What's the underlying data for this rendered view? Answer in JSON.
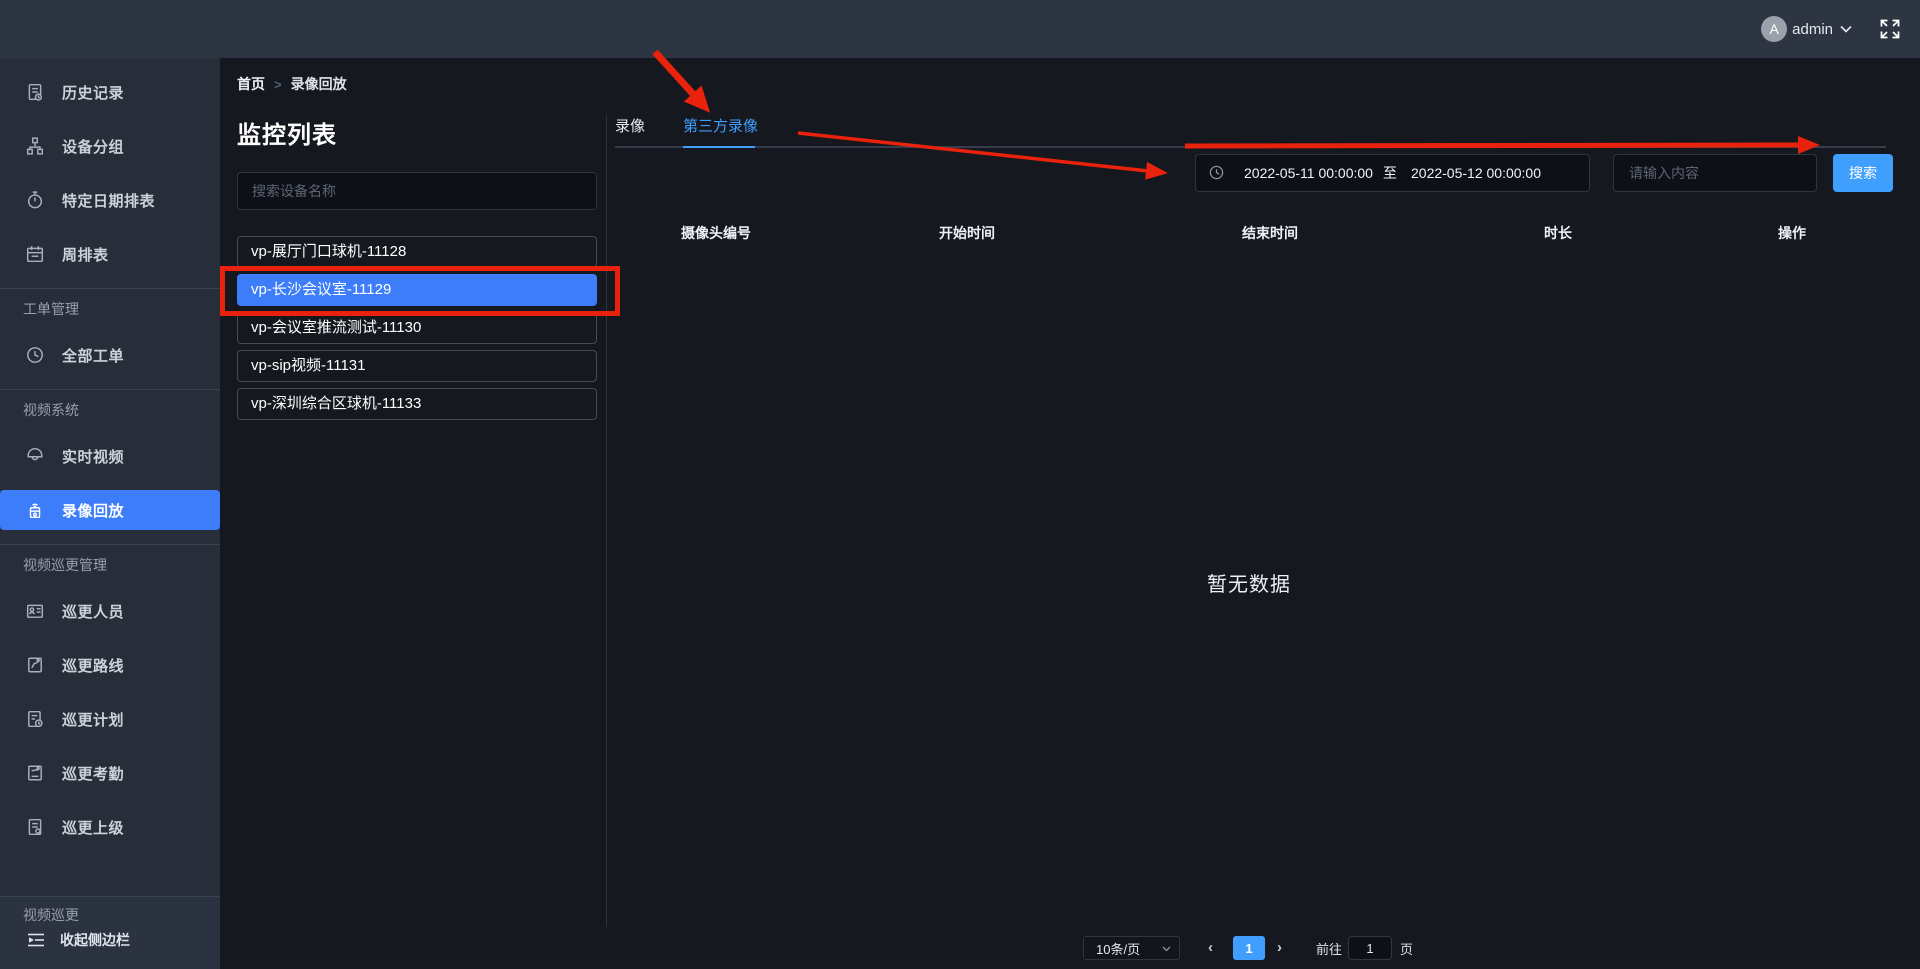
{
  "topbar": {
    "username": "admin",
    "avatar_letter": "A"
  },
  "breadcrumb": {
    "home": "首页",
    "separator": ">",
    "current": "录像回放"
  },
  "sidebar": {
    "items": [
      {
        "label": "历史记录",
        "icon": "history-icon"
      },
      {
        "label": "设备分组",
        "icon": "device-group-icon"
      },
      {
        "label": "特定日期排表",
        "icon": "date-schedule-icon"
      },
      {
        "label": "周排表",
        "icon": "week-schedule-icon"
      },
      {
        "label": "全部工单",
        "icon": "all-orders-icon"
      },
      {
        "label": "实时视频",
        "icon": "live-video-icon"
      },
      {
        "label": "录像回放",
        "icon": "video-playback-icon",
        "active": true
      },
      {
        "label": "巡更人员",
        "icon": "patrol-person-icon"
      },
      {
        "label": "巡更路线",
        "icon": "patrol-route-icon"
      },
      {
        "label": "巡更计划",
        "icon": "patrol-plan-icon"
      },
      {
        "label": "巡更考勤",
        "icon": "patrol-attendance-icon"
      },
      {
        "label": "巡更上级",
        "icon": "patrol-superior-icon"
      }
    ],
    "sections": {
      "work_order": "工单管理",
      "video_system": "视频系统",
      "video_patrol_mgmt": "视频巡更管理",
      "video_patrol": "视频巡更"
    },
    "collapse": "收起侧边栏"
  },
  "monitor_panel": {
    "title": "监控列表",
    "search_placeholder": "搜索设备名称",
    "devices": [
      {
        "name": "vp-展厅门口球机-11128"
      },
      {
        "name": "vp-长沙会议室-11129",
        "selected": true
      },
      {
        "name": "vp-会议室推流测试-11130"
      },
      {
        "name": "vp-sip视频-11131"
      },
      {
        "name": "vp-深圳综合区球机-11133"
      }
    ]
  },
  "content": {
    "tabs": [
      {
        "label": "录像"
      },
      {
        "label": "第三方录像",
        "active": true
      }
    ],
    "toolbar": {
      "date_start": "2022-05-11 00:00:00",
      "date_separator": "至",
      "date_end": "2022-05-12 00:00:00",
      "keyword_placeholder": "请输入内容",
      "search_button": "搜索"
    },
    "table": {
      "columns": [
        "摄像头编号",
        "开始时间",
        "结束时间",
        "时长",
        "操作"
      ],
      "rows": [],
      "empty_text": "暂无数据"
    },
    "pagination": {
      "page_size": "10条/页",
      "prev": "‹",
      "current_page": "1",
      "next": "›",
      "goto_label": "前往",
      "goto_value": "1",
      "unit_label": "页"
    }
  },
  "colors": {
    "accent": "#409eff",
    "selected_device": "#3d7dfa",
    "annotation_red": "#e8220c",
    "topbar_bg": "#2d3442",
    "sidebar_bg": "#272d39",
    "main_bg": "#15181f"
  }
}
